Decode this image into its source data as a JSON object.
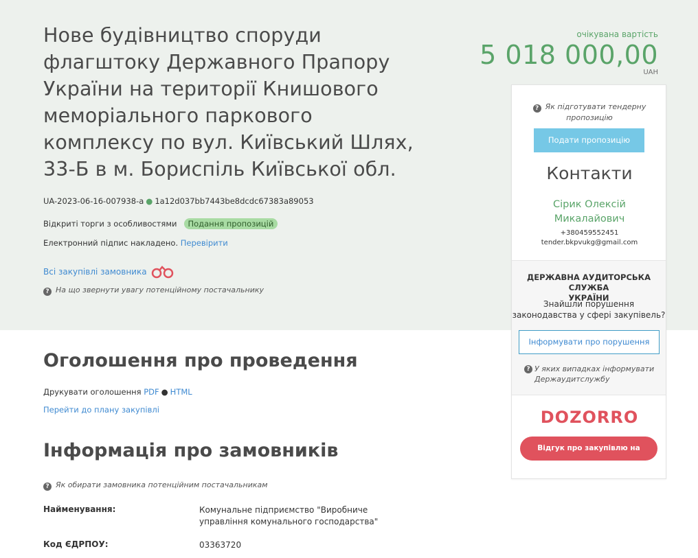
{
  "tender": {
    "title": "Нове будівництво споруди флагштоку Державного Прапору України на території Книшового меморіального паркового комплексу по вул. Київський Шлях, 33-Б в м. Бориспіль Київської обл.",
    "id": "UA-2023-06-16-007938-a",
    "hash": "1a12d037bb7443be8dcdc67383a89053",
    "procedure_type": "Відкриті торги з особливостями",
    "status_badge": "Подання пропозицій",
    "signature_text": "Електронний підпис накладено.",
    "signature_link": "Перевірити",
    "all_purchases_link": "Всі закупівлі замовника",
    "supplier_hint": "На що звернути увагу потенційному постачальнику"
  },
  "price": {
    "label": "очікувана вартість",
    "amount": "5 018 000,00",
    "currency": "UAH"
  },
  "sidebar": {
    "help_line1": "Як підготувати тендерну",
    "help_line2": "пропозицію",
    "offer_button": "Подати пропозицію",
    "contacts_title": "Контакти",
    "contact_name_line1": "Сірик Олексій",
    "contact_name_line2": "Микалайович",
    "contact_phone": "+380459552451",
    "contact_email": "tender.bkpvukg@gmail.com",
    "audit_title_line1": "ДЕРЖАВНА АУДИТОРСЬКА СЛУЖБА",
    "audit_title_line2": "УКРАЇНИ",
    "audit_text_line1": "Знайшли порушення",
    "audit_text_line2": "законодавства у сфері закупівель?",
    "audit_button": "Інформувати про порушення",
    "audit_hint_line1": "У яких випадках інформувати",
    "audit_hint_line2": "Держаудитслужбу",
    "dozorro_logo": "DOZORRO",
    "dozorro_button": "Відгук про закупівлю на Дозорро"
  },
  "announcement": {
    "title": "Оголошення про проведення",
    "print_label": "Друкувати оголошення",
    "pdf_link": "PDF",
    "html_link": "HTML",
    "plan_link": "Перейти до плану закупівлі"
  },
  "customers": {
    "title": "Інформація про замовників",
    "hint": "Як обирати замовника потенційним постачальникам",
    "name_label": "Найменування:",
    "name_value_line1": "Комунальне підприємство \"Виробниче",
    "name_value_line2": "управління комунального господарства\"",
    "edrpou_label": "Код ЄДРПОУ:",
    "edrpou_value": "03363720"
  },
  "colors": {
    "hero_bg": "#edf1ed",
    "accent_green": "#5aa469",
    "link_blue": "#3f8ad1",
    "offer_button": "#76c8e6",
    "dozorro_red": "#e0525d"
  }
}
